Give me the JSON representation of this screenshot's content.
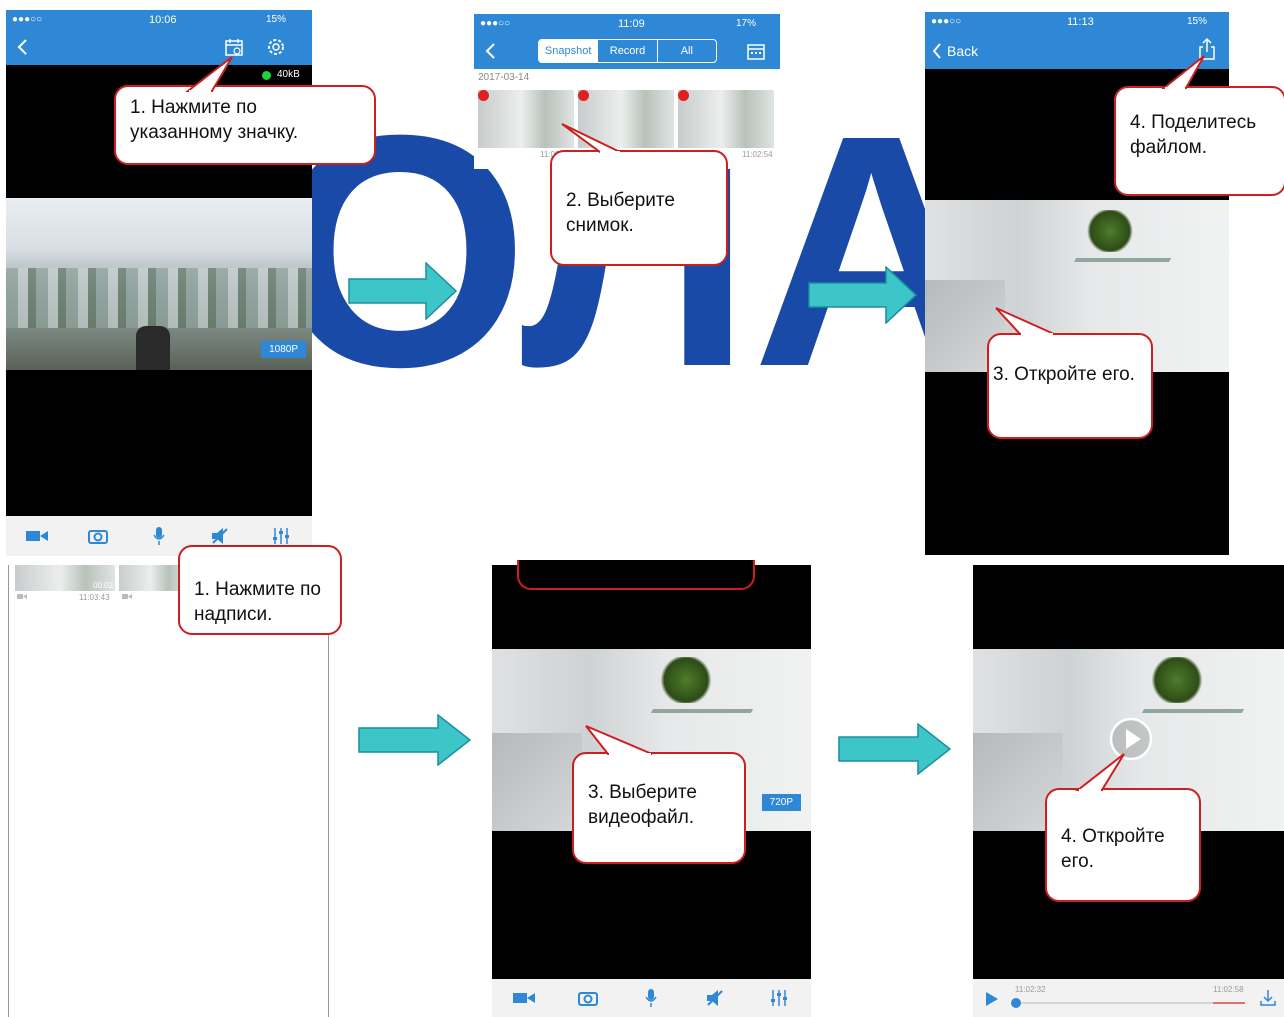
{
  "watermark": "РОЛАЙ",
  "colors": {
    "accent": "#2f88d6",
    "callout_border": "#cc1f1f",
    "arrow": "#3cc6c8",
    "watermark": "#1a4aa8"
  },
  "panel1": {
    "status": {
      "carrier": "●●●○○",
      "time": "10:06",
      "battery": "15%"
    },
    "bitrate": "40kB",
    "resolution": "1080P",
    "toolbar_icons": [
      "record-icon",
      "camera-icon",
      "mic-icon",
      "mute-icon",
      "equalizer-icon"
    ],
    "callout": "1. Нажмите по указанному значку."
  },
  "panel2": {
    "status": {
      "carrier": "●●●○○",
      "time": "11:09",
      "battery": "17%"
    },
    "tabs": [
      "Snapshot",
      "Record",
      "All"
    ],
    "selected_tab": "Snapshot",
    "date": "2017-03-14",
    "thumb_times": [
      "11:03",
      "11:02:54"
    ],
    "callout": "2. Выберите снимок."
  },
  "panel3": {
    "status": {
      "carrier": "●●●○○",
      "time": "11:13",
      "battery": "15%"
    },
    "back_label": "Back",
    "callout_share": "4. Поделитесь файлом.",
    "callout_open": "3. Откройте его."
  },
  "panel4": {
    "thumb_times": [
      "00:02",
      "11:03:43"
    ],
    "callout": "1. Нажмите по надписи."
  },
  "panel5": {
    "resolution": "720P",
    "callout": "3. Выберите видеофайл."
  },
  "panel6": {
    "time_start": "11:02:32",
    "time_end": "11:02:58",
    "callout": "4. Откройте его."
  }
}
